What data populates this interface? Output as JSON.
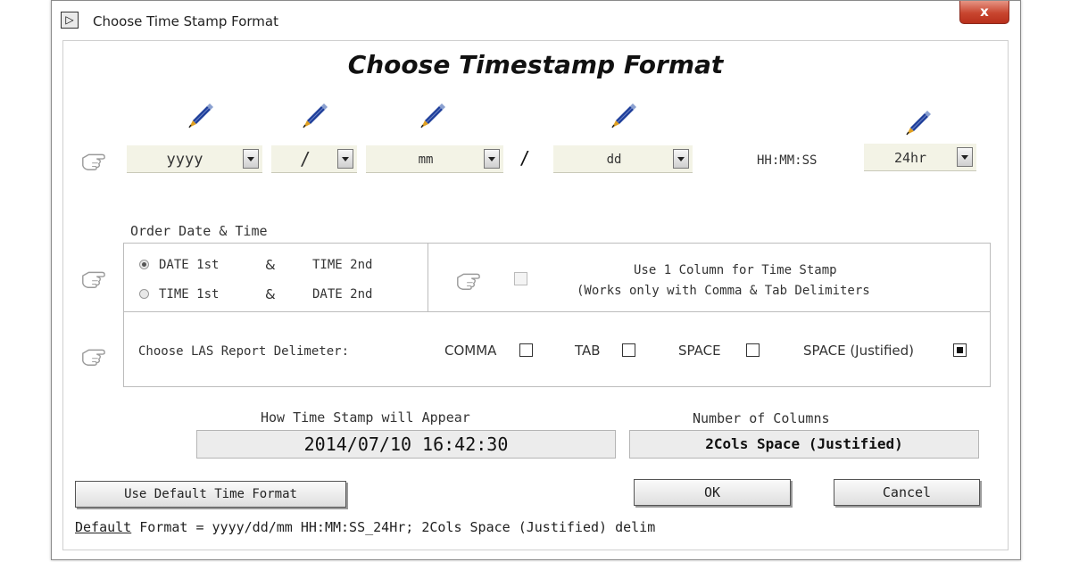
{
  "window": {
    "title": "Choose Time Stamp Format",
    "close_symbol": "x",
    "app_icon": "app-icon"
  },
  "heading": "Choose Timestamp Format",
  "format_row": {
    "year": "yyyy",
    "separator1": "/",
    "month": "mm",
    "separator2": "/",
    "day": "dd",
    "time_label": "HH:MM:SS",
    "hour_mode": "24hr"
  },
  "order": {
    "label": "Order Date & Time",
    "option1": {
      "a": "DATE 1st",
      "amp": "&",
      "b": "TIME 2nd",
      "selected": true
    },
    "option2": {
      "a": "TIME 1st",
      "amp": "&",
      "b": "DATE 2nd",
      "selected": false
    },
    "one_column_line1": "Use 1 Column for Time Stamp",
    "one_column_line2": "(Works only with Comma & Tab Delimiters"
  },
  "delimiter": {
    "label": "Choose LAS Report Delimeter:",
    "comma": "COMMA",
    "tab": "TAB",
    "space": "SPACE",
    "space_justified": "SPACE (Justified)",
    "selected": "space_justified"
  },
  "preview": {
    "label": "How Time Stamp will Appear",
    "value": "2014/07/10 16:42:30",
    "columns_label": "Number of Columns",
    "columns_value": "2Cols Space (Justified)"
  },
  "buttons": {
    "default": "Use Default Time Format",
    "ok": "OK",
    "cancel": "Cancel"
  },
  "footer": {
    "prefix": "Default",
    "text": " Format = yyyy/dd/mm HH:MM:SS_24Hr; 2Cols Space (Justified) delim"
  },
  "colors": {
    "pencil_body": "#1f3f9a",
    "pencil_tip": "#e0a020",
    "close_red": "#c8452f"
  }
}
